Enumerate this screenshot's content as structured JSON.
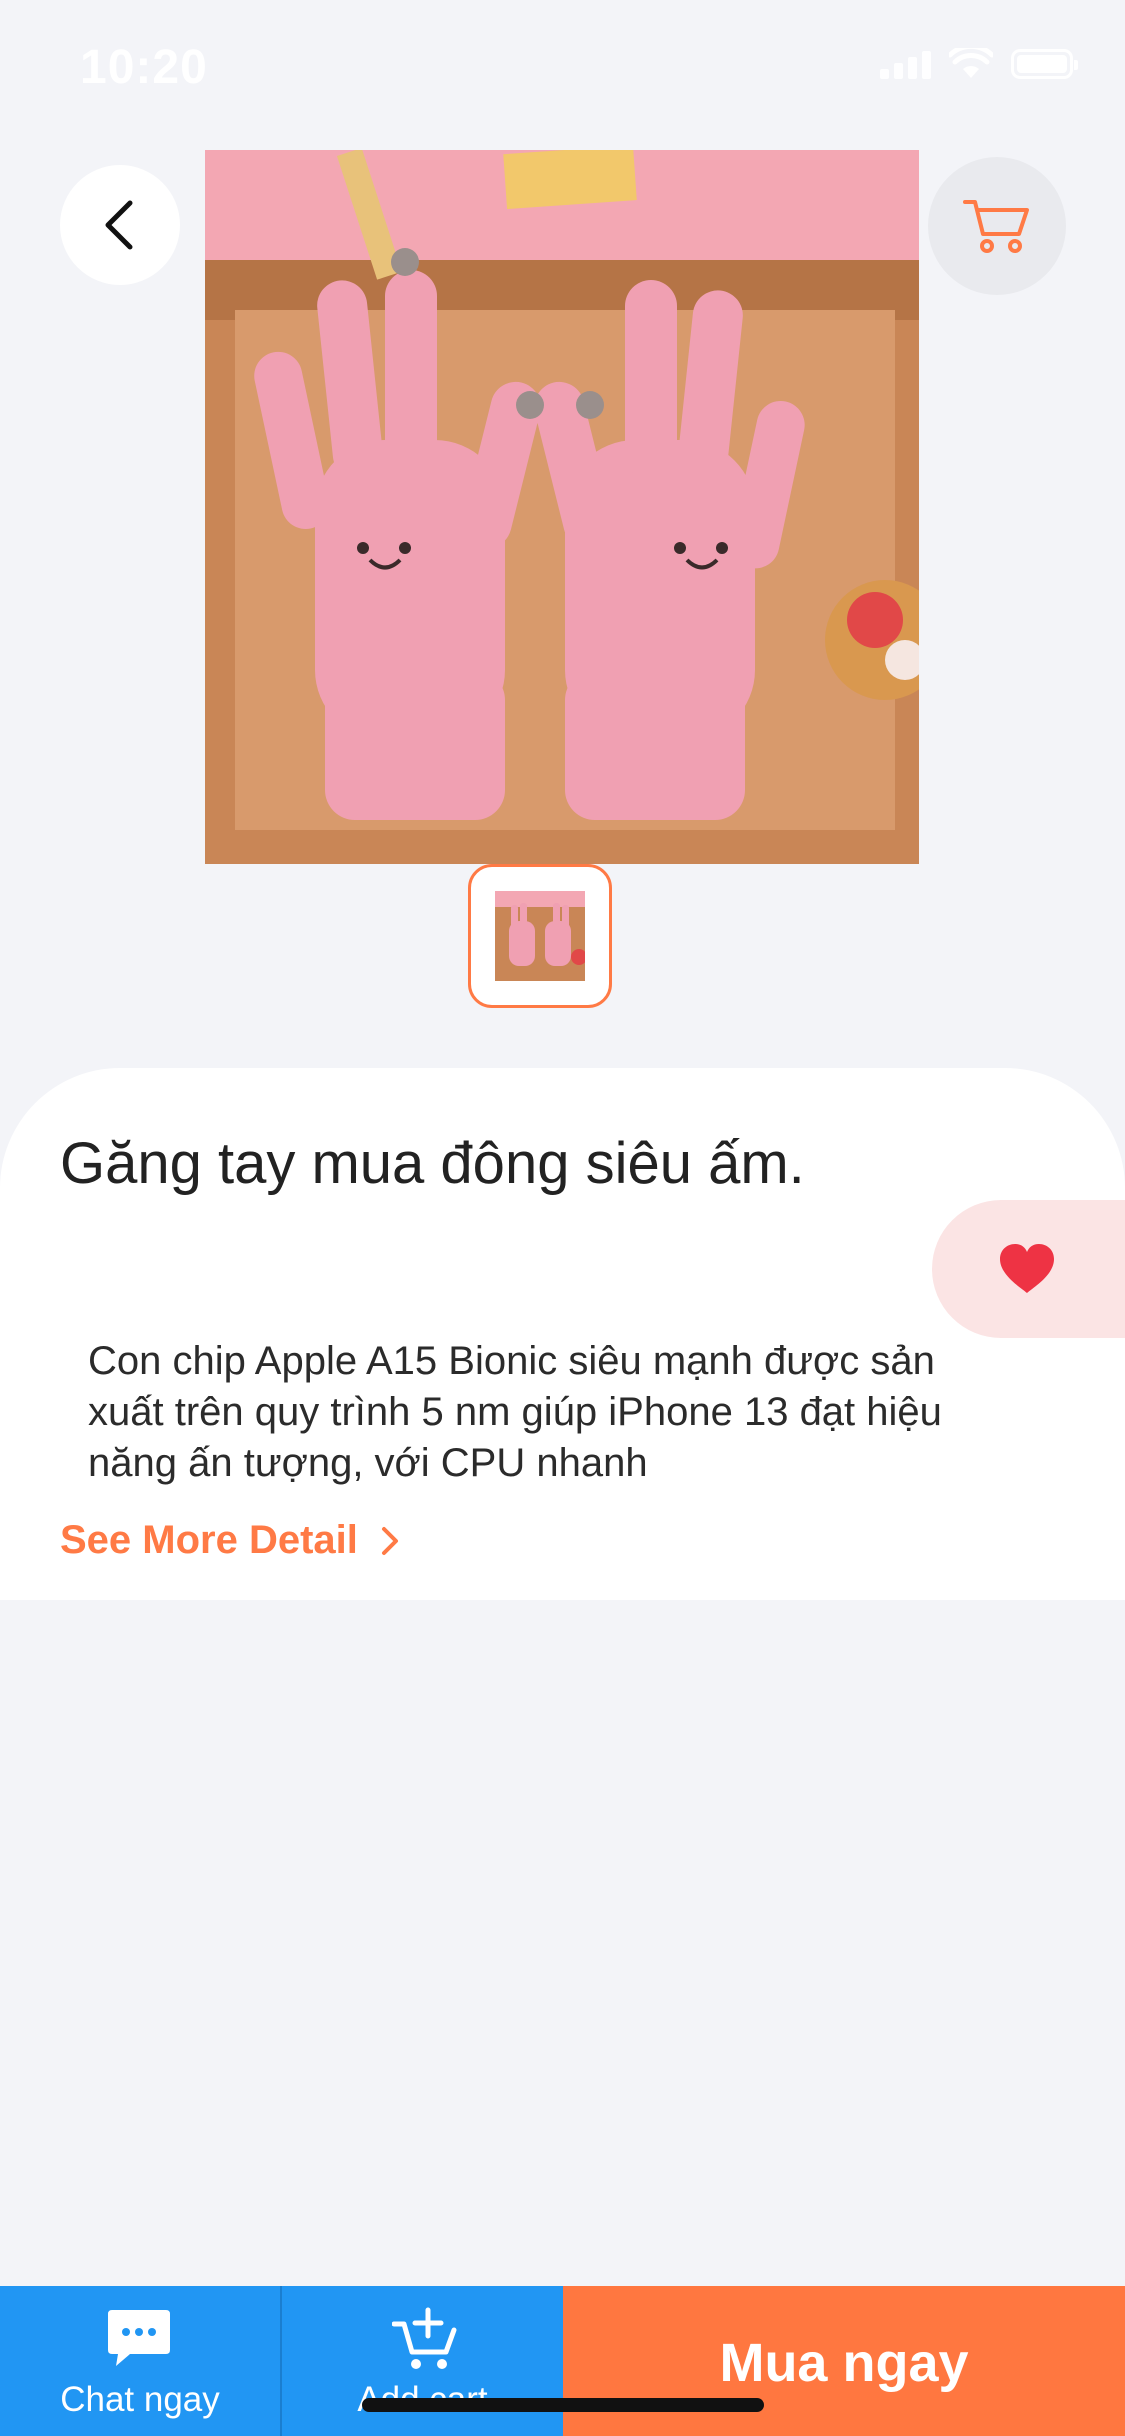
{
  "status_bar": {
    "time": "10:20"
  },
  "product": {
    "image_alt": "pink knitted gloves",
    "title": "Găng tay mua đông siêu ấm.",
    "description": "Con chip Apple A15 Bionic siêu mạnh được sản xuất trên quy trình 5 nm giúp iPhone 13 đạt hiệu năng ấn tượng, với CPU nhanh",
    "see_more_label": "See More Detail"
  },
  "bottom_bar": {
    "chat_label": "Chat ngay",
    "add_cart_label": "Add cart",
    "buy_label": "Mua ngay"
  },
  "colors": {
    "accent": "#ff7a45",
    "primary_blue": "#2196f3",
    "favorite_red": "#ee3344",
    "background": "#f3f4f8"
  },
  "icons": {
    "back": "chevron-left-icon",
    "cart": "shopping-cart-icon",
    "favorite": "heart-icon",
    "chat": "chat-bubble-icon",
    "add_cart": "cart-plus-icon",
    "see_more": "chevron-right-icon"
  }
}
